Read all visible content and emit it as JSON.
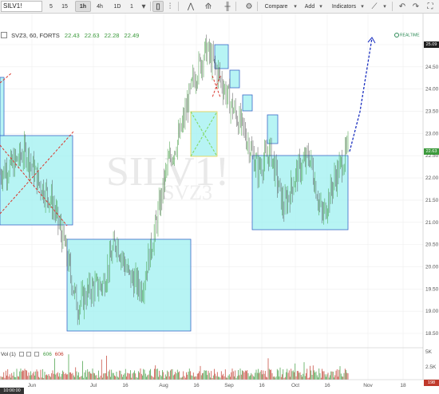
{
  "toolbar": {
    "symbol": "SILV1!",
    "intervals": [
      "5",
      "15",
      "1h",
      "4h",
      "1D",
      "1"
    ],
    "active_interval": "1h",
    "buttons": {
      "compare": "Compare",
      "add": "Add",
      "indicators": "Indicators"
    }
  },
  "legend": {
    "title": "SVZ3, 60, FORTS",
    "open": "22.43",
    "high": "22.63",
    "low": "22.28",
    "close": "22.49"
  },
  "realtime_label": "REALTIME",
  "watermark": {
    "symbol": "SILV1!",
    "sub": "SVZ3"
  },
  "volume_legend": {
    "label": "Vol (1)",
    "value1": "606",
    "value2": "606"
  },
  "price_axis": {
    "ticks": [
      "25.00",
      "24.50",
      "24.00",
      "23.50",
      "23.00",
      "22.50",
      "22.00",
      "21.50",
      "21.00",
      "20.50",
      "20.00",
      "19.50",
      "19.00",
      "18.50"
    ],
    "top_tag": "25.09",
    "current_tag": "22.63"
  },
  "volume_axis": {
    "ticks": [
      "5K",
      "2.5K"
    ],
    "current_tag": "198"
  },
  "time_axis": {
    "labels": [
      "Jun",
      "Jul",
      "16",
      "Aug",
      "16",
      "Sep",
      "16",
      "Oct",
      "16",
      "Nov",
      "18"
    ],
    "start_tag": "10:00:00"
  },
  "colors": {
    "box_fill": "#9ff0f0",
    "box_stroke": "#3a68c8",
    "trend_line": "#d9362c",
    "projection": "#1a2fc0",
    "candle_up": "#3c9a3c",
    "candle_down": "#555555",
    "price_tag_bg": "#3c9a3c"
  },
  "chart_data": {
    "type": "candlestick",
    "symbol": "SVZ3",
    "timeframe": "60",
    "yrange": [
      18.3,
      25.3
    ],
    "path": [
      [
        "start",
        22.1
      ],
      [
        "Jun",
        22.3
      ],
      [
        "Jun+",
        22.6
      ],
      [
        "Jun++",
        21.9
      ],
      [
        "late Jun",
        21.5
      ],
      [
        "early Jul",
        20.5
      ],
      [
        "Jul",
        19.1
      ],
      [
        "Jul+",
        19.5
      ],
      [
        "16",
        19.6
      ],
      [
        "late Jul",
        20.6
      ],
      [
        "late Jul+",
        19.8
      ],
      [
        "Aug",
        19.5
      ],
      [
        "Aug+",
        20.8
      ],
      [
        "mid Aug",
        22.3
      ],
      [
        "16",
        23.0
      ],
      [
        "late Aug",
        24.2
      ],
      [
        "late Aug+",
        24.9
      ],
      [
        "Sep",
        24.3
      ],
      [
        "Sep+",
        23.6
      ],
      [
        "16",
        23.0
      ],
      [
        "mid Sep",
        22.2
      ],
      [
        "late Sep",
        22.6
      ],
      [
        "Oct",
        21.3
      ],
      [
        "Oct+",
        22.1
      ],
      [
        "16",
        22.5
      ],
      [
        "mid Oct",
        21.1
      ],
      [
        "late Oct",
        22.0
      ],
      [
        "now",
        22.63
      ]
    ],
    "projection_target": 25.09,
    "volume_max": "5K"
  }
}
